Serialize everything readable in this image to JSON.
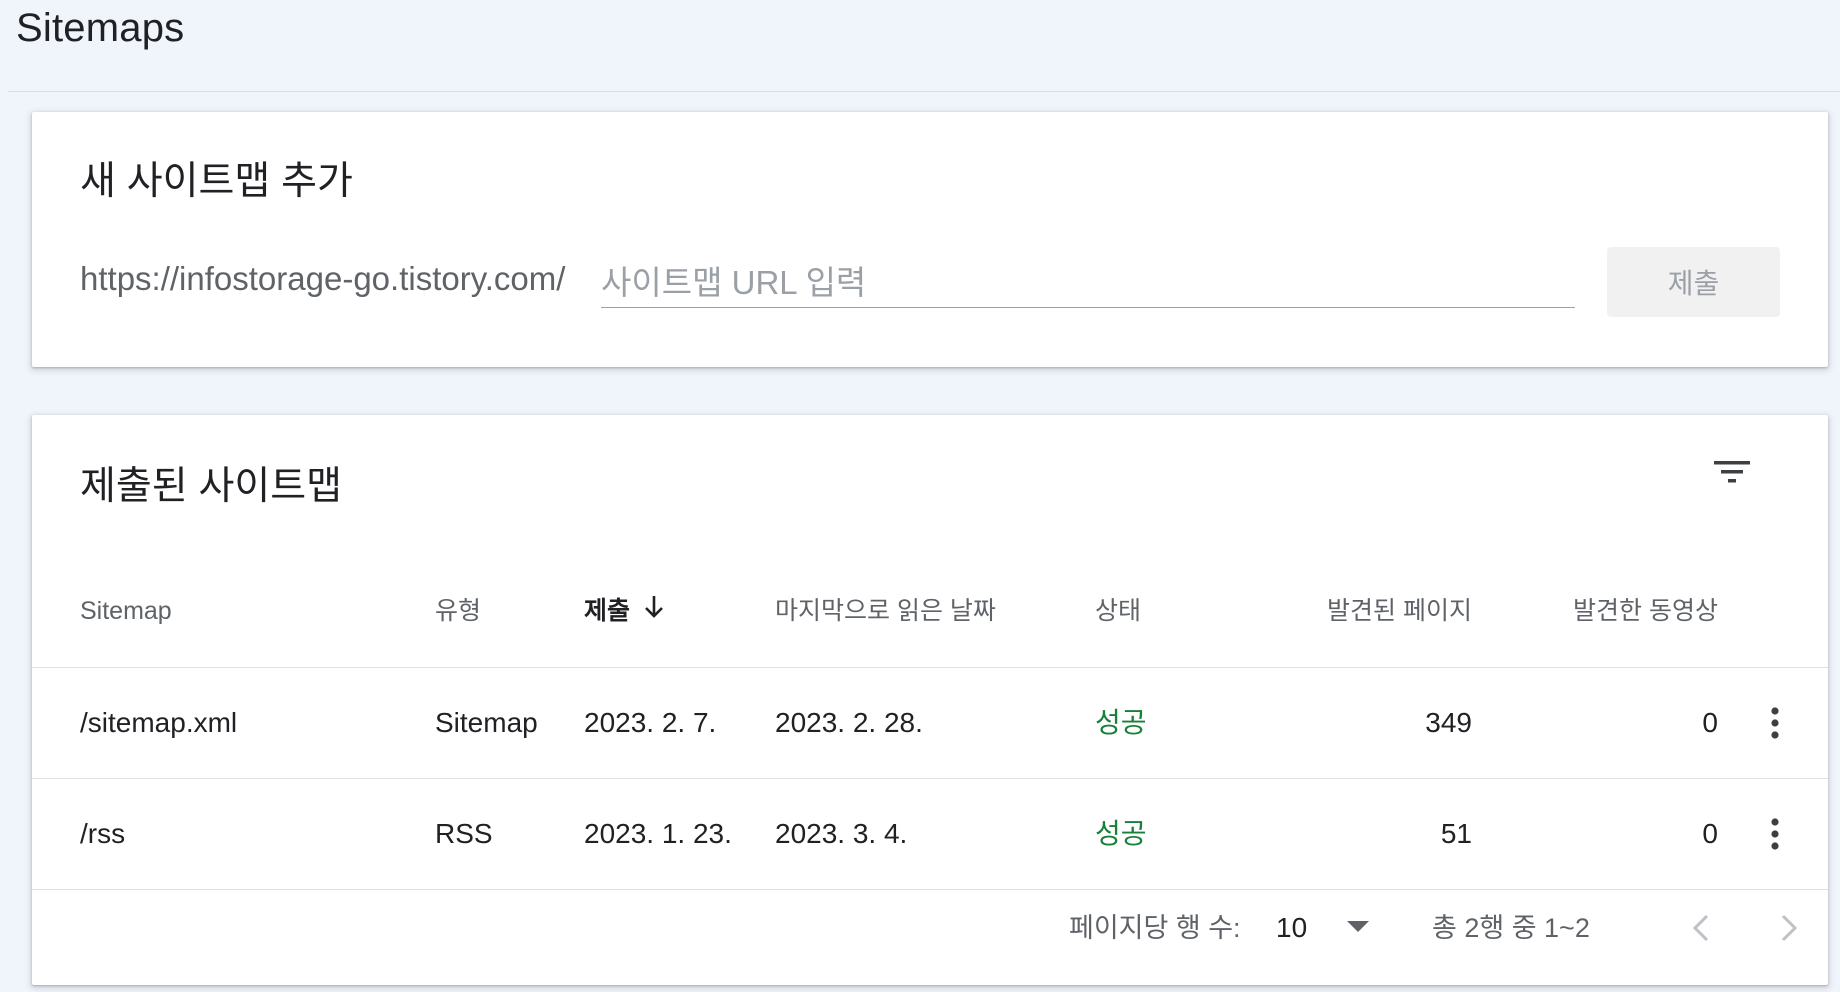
{
  "header": {
    "title": "Sitemaps"
  },
  "add_sitemap": {
    "title": "새 사이트맵 추가",
    "url_prefix": "https://infostorage-go.tistory.com/",
    "input_placeholder": "사이트맵 URL 입력",
    "input_value": "",
    "submit_label": "제출"
  },
  "submitted": {
    "title": "제출된 사이트맵",
    "columns": {
      "sitemap": "Sitemap",
      "type": "유형",
      "submitted": "제출",
      "last_read": "마지막으로 읽은 날짜",
      "status": "상태",
      "pages_found": "발견된 페이지",
      "videos_found": "발견한 동영상"
    },
    "sort": {
      "column": "submitted",
      "direction": "descending"
    },
    "rows": [
      {
        "sitemap": "/sitemap.xml",
        "type": "Sitemap",
        "submitted": "2023. 2. 7.",
        "last_read": "2023. 2. 28.",
        "status": "성공",
        "pages_found": "349",
        "videos_found": "0"
      },
      {
        "sitemap": "/rss",
        "type": "RSS",
        "submitted": "2023. 1. 23.",
        "last_read": "2023. 3. 4.",
        "status": "성공",
        "pages_found": "51",
        "videos_found": "0"
      }
    ],
    "pagination": {
      "rows_per_page_label": "페이지당 행 수:",
      "rows_per_page_value": "10",
      "range_label": "총 2행 중 1~2"
    }
  },
  "colors": {
    "background": "#f0f4fb",
    "status_success": "#188038",
    "text_secondary": "#5f6368"
  },
  "icons": [
    "filter-icon",
    "sort-down-arrow-icon",
    "more-vert-icon",
    "dropdown-arrow-icon",
    "chevron-left-icon",
    "chevron-right-icon"
  ]
}
